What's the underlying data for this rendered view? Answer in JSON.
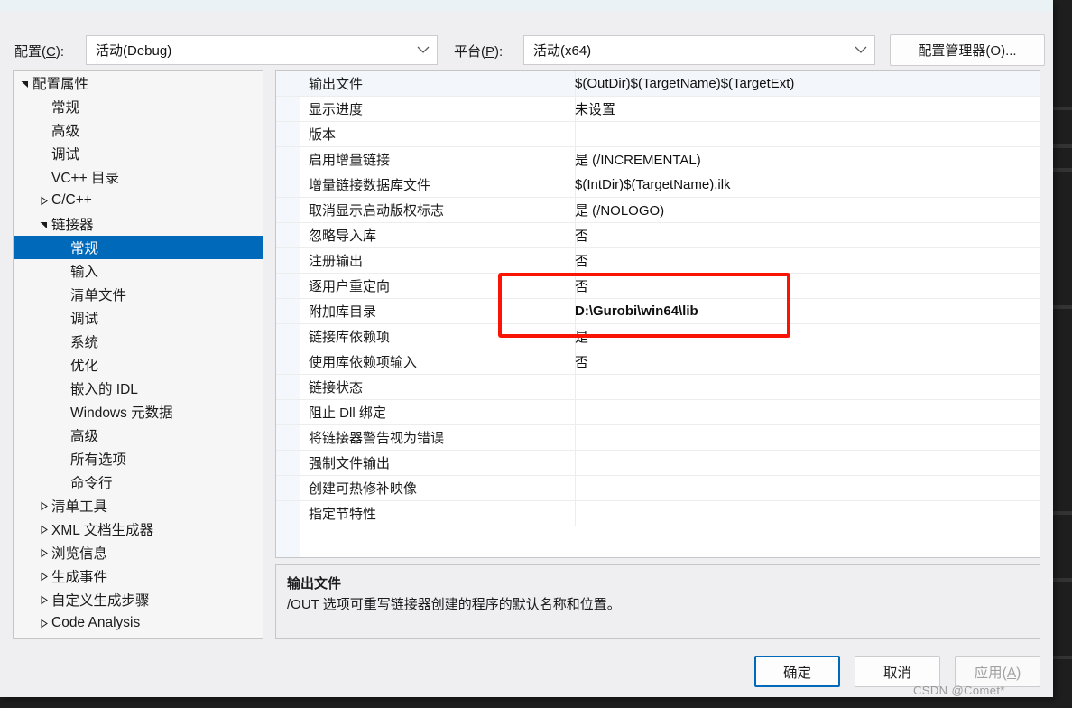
{
  "dialog": {
    "header": {
      "config_label": "配置(C):",
      "config_label_plain": "配置",
      "config_accel": "C",
      "config_value": "活动(Debug)",
      "platform_label_plain": "平台",
      "platform_accel": "P",
      "platform_value": "活动(x64)",
      "config_manager_button": "配置管理器(O)..."
    },
    "tree": {
      "items": [
        {
          "label": "配置属性",
          "indent": 0,
          "twisty": "expanded",
          "selected": false
        },
        {
          "label": "常规",
          "indent": 1,
          "twisty": "none",
          "selected": false
        },
        {
          "label": "高级",
          "indent": 1,
          "twisty": "none",
          "selected": false
        },
        {
          "label": "调试",
          "indent": 1,
          "twisty": "none",
          "selected": false
        },
        {
          "label": "VC++ 目录",
          "indent": 1,
          "twisty": "none",
          "selected": false
        },
        {
          "label": "C/C++",
          "indent": 1,
          "twisty": "collapsed",
          "selected": false
        },
        {
          "label": "链接器",
          "indent": 1,
          "twisty": "expanded",
          "selected": false
        },
        {
          "label": "常规",
          "indent": 2,
          "twisty": "none",
          "selected": true
        },
        {
          "label": "输入",
          "indent": 2,
          "twisty": "none",
          "selected": false
        },
        {
          "label": "清单文件",
          "indent": 2,
          "twisty": "none",
          "selected": false
        },
        {
          "label": "调试",
          "indent": 2,
          "twisty": "none",
          "selected": false
        },
        {
          "label": "系统",
          "indent": 2,
          "twisty": "none",
          "selected": false
        },
        {
          "label": "优化",
          "indent": 2,
          "twisty": "none",
          "selected": false
        },
        {
          "label": "嵌入的 IDL",
          "indent": 2,
          "twisty": "none",
          "selected": false
        },
        {
          "label": "Windows 元数据",
          "indent": 2,
          "twisty": "none",
          "selected": false
        },
        {
          "label": "高级",
          "indent": 2,
          "twisty": "none",
          "selected": false
        },
        {
          "label": "所有选项",
          "indent": 2,
          "twisty": "none",
          "selected": false
        },
        {
          "label": "命令行",
          "indent": 2,
          "twisty": "none",
          "selected": false
        },
        {
          "label": "清单工具",
          "indent": 1,
          "twisty": "collapsed",
          "selected": false
        },
        {
          "label": "XML 文档生成器",
          "indent": 1,
          "twisty": "collapsed",
          "selected": false
        },
        {
          "label": "浏览信息",
          "indent": 1,
          "twisty": "collapsed",
          "selected": false
        },
        {
          "label": "生成事件",
          "indent": 1,
          "twisty": "collapsed",
          "selected": false
        },
        {
          "label": "自定义生成步骤",
          "indent": 1,
          "twisty": "collapsed",
          "selected": false
        },
        {
          "label": "Code Analysis",
          "indent": 1,
          "twisty": "collapsed",
          "selected": false
        }
      ]
    },
    "grid": {
      "rows": [
        {
          "name": "输出文件",
          "value": "$(OutDir)$(TargetName)$(TargetExt)",
          "selected": true,
          "bold": false
        },
        {
          "name": "显示进度",
          "value": "未设置",
          "selected": false,
          "bold": false
        },
        {
          "name": "版本",
          "value": "",
          "selected": false,
          "bold": false
        },
        {
          "name": "启用增量链接",
          "value": "是 (/INCREMENTAL)",
          "selected": false,
          "bold": false
        },
        {
          "name": "增量链接数据库文件",
          "value": "$(IntDir)$(TargetName).ilk",
          "selected": false,
          "bold": false
        },
        {
          "name": "取消显示启动版权标志",
          "value": "是 (/NOLOGO)",
          "selected": false,
          "bold": false
        },
        {
          "name": "忽略导入库",
          "value": "否",
          "selected": false,
          "bold": false
        },
        {
          "name": "注册输出",
          "value": "否",
          "selected": false,
          "bold": false
        },
        {
          "name": "逐用户重定向",
          "value": "否",
          "selected": false,
          "bold": false
        },
        {
          "name": "附加库目录",
          "value": "D:\\Gurobi\\win64\\lib",
          "selected": false,
          "bold": true
        },
        {
          "name": "链接库依赖项",
          "value": "是",
          "selected": false,
          "bold": false
        },
        {
          "name": "使用库依赖项输入",
          "value": "否",
          "selected": false,
          "bold": false
        },
        {
          "name": "链接状态",
          "value": "",
          "selected": false,
          "bold": false
        },
        {
          "name": "阻止 Dll 绑定",
          "value": "",
          "selected": false,
          "bold": false
        },
        {
          "name": "将链接器警告视为错误",
          "value": "",
          "selected": false,
          "bold": false
        },
        {
          "name": "强制文件输出",
          "value": "",
          "selected": false,
          "bold": false
        },
        {
          "name": "创建可热修补映像",
          "value": "",
          "selected": false,
          "bold": false
        },
        {
          "name": "指定节特性",
          "value": "",
          "selected": false,
          "bold": false
        }
      ]
    },
    "description": {
      "title": "输出文件",
      "text": "/OUT 选项可重写链接器创建的程序的默认名称和位置。"
    },
    "footer": {
      "ok": "确定",
      "cancel": "取消",
      "apply_plain": "应用",
      "apply_accel": "A"
    },
    "watermark": "CSDN @Comet*",
    "colors": {
      "selection_blue": "#0069ba",
      "annotation_red": "#fa1405",
      "dialog_bg": "#efeff1"
    }
  }
}
